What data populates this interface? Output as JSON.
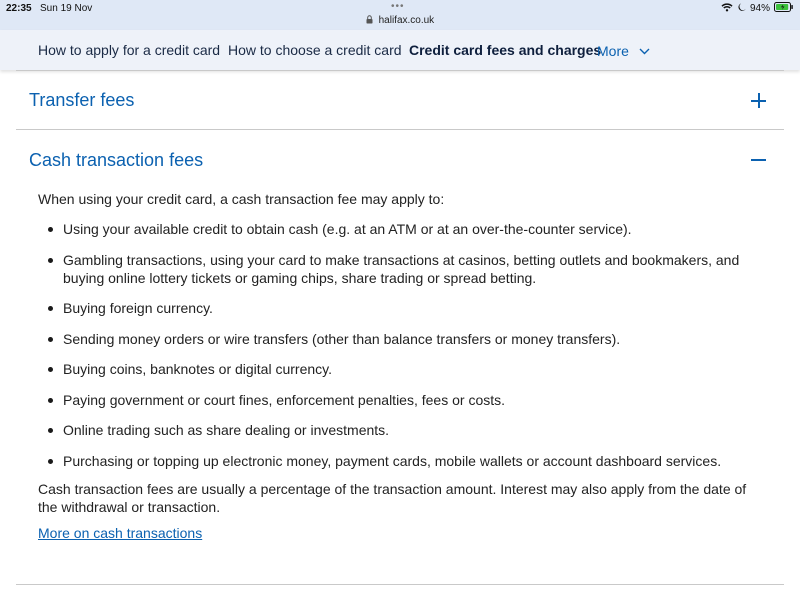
{
  "status_bar": {
    "time": "22:35",
    "date": "Sun 19 Nov",
    "url": "halifax.co.uk",
    "battery": "94%",
    "icons": [
      "wifi-icon",
      "moon-icon",
      "battery-icon"
    ],
    "battery_level": 0.94
  },
  "nav": {
    "items": [
      "How to apply for a credit card",
      "How to choose a credit card",
      "Credit card fees and charges",
      "More"
    ],
    "active_item": "Credit card fees and charges"
  },
  "accordions": [
    {
      "title": "Transfer fees",
      "expanded": false,
      "icon": "plus-icon"
    },
    {
      "title": "Cash transaction fees",
      "expanded": true,
      "icon": "minus-icon"
    }
  ],
  "cash_section": {
    "intro": "When using your credit card, a cash transaction fee may apply to:",
    "bullets": [
      "Using your available credit to obtain cash (e.g. at an ATM or at an over-the-counter service).",
      "Gambling transactions, using your card to make transactions at casinos, betting outlets and bookmakers, and buying online lottery tickets or gaming chips, share trading or spread betting.",
      "Buying foreign currency.",
      "Sending money orders or wire transfers (other than balance transfers or money transfers).",
      "Buying coins, banknotes or digital currency.",
      "Paying government or court fines, enforcement penalties, fees or costs.",
      "Online trading such as share dealing or investments.",
      "Purchasing or topping up electronic money, payment cards, mobile wallets or account dashboard services."
    ],
    "outro": "Cash transaction fees are usually a percentage of the transaction amount. Interest may also apply from the date of the withdrawal or transaction.",
    "link": "More on cash transactions"
  },
  "colors": {
    "link_blue": "#0b61b0",
    "nav_bg": "#eef2f9",
    "status_bg": "#dfe8f6",
    "battery_green": "#3cc13c"
  }
}
